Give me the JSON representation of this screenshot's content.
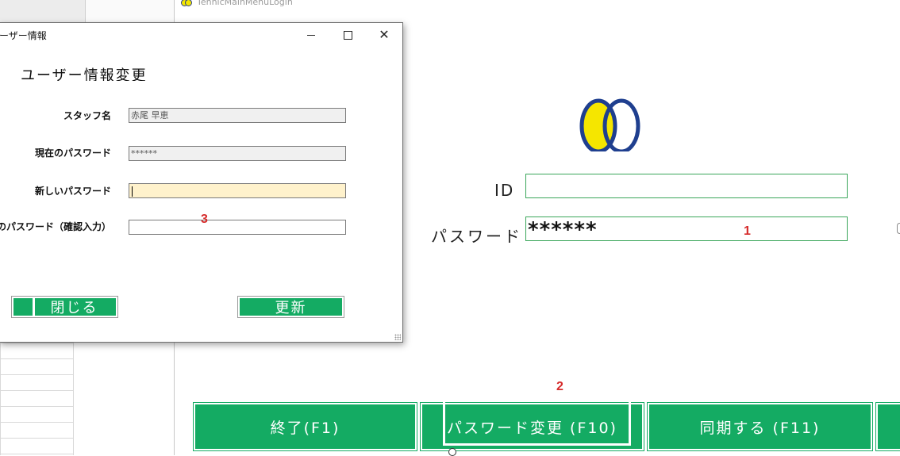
{
  "main_window": {
    "title": "TennicMainMenuLogin",
    "id_label": "ID",
    "id_value": "",
    "password_label": "パスワード",
    "password_value": "******",
    "buttons": {
      "exit": "終了(F1)",
      "change_password": "パスワード変更 (F10)",
      "sync": "同期する (F11)"
    },
    "logo": {
      "ring_color": "#1f3f8f",
      "fill_color": "#f5e600",
      "icon": "two-rings-logo"
    }
  },
  "annotations": [
    "1",
    "2",
    "3"
  ],
  "dialog": {
    "title": "ーザー情報",
    "heading": "ユーザー情報変更",
    "fields": {
      "staff_name": {
        "label": "スタッフ名",
        "value": "赤尾 早恵"
      },
      "current_password": {
        "label": "現在のパスワード",
        "value": "******"
      },
      "new_password": {
        "label": "新しいパスワード",
        "value": ""
      },
      "confirm_password": {
        "label": "のパスワード（確認入力）",
        "value": ""
      }
    },
    "close_button": "閉じる",
    "update_button": "更新"
  },
  "colors": {
    "button_green": "#14ab63",
    "field_border": "#3aa65a",
    "annotation_red": "#d62b2b",
    "active_field": "#fff2cc"
  }
}
